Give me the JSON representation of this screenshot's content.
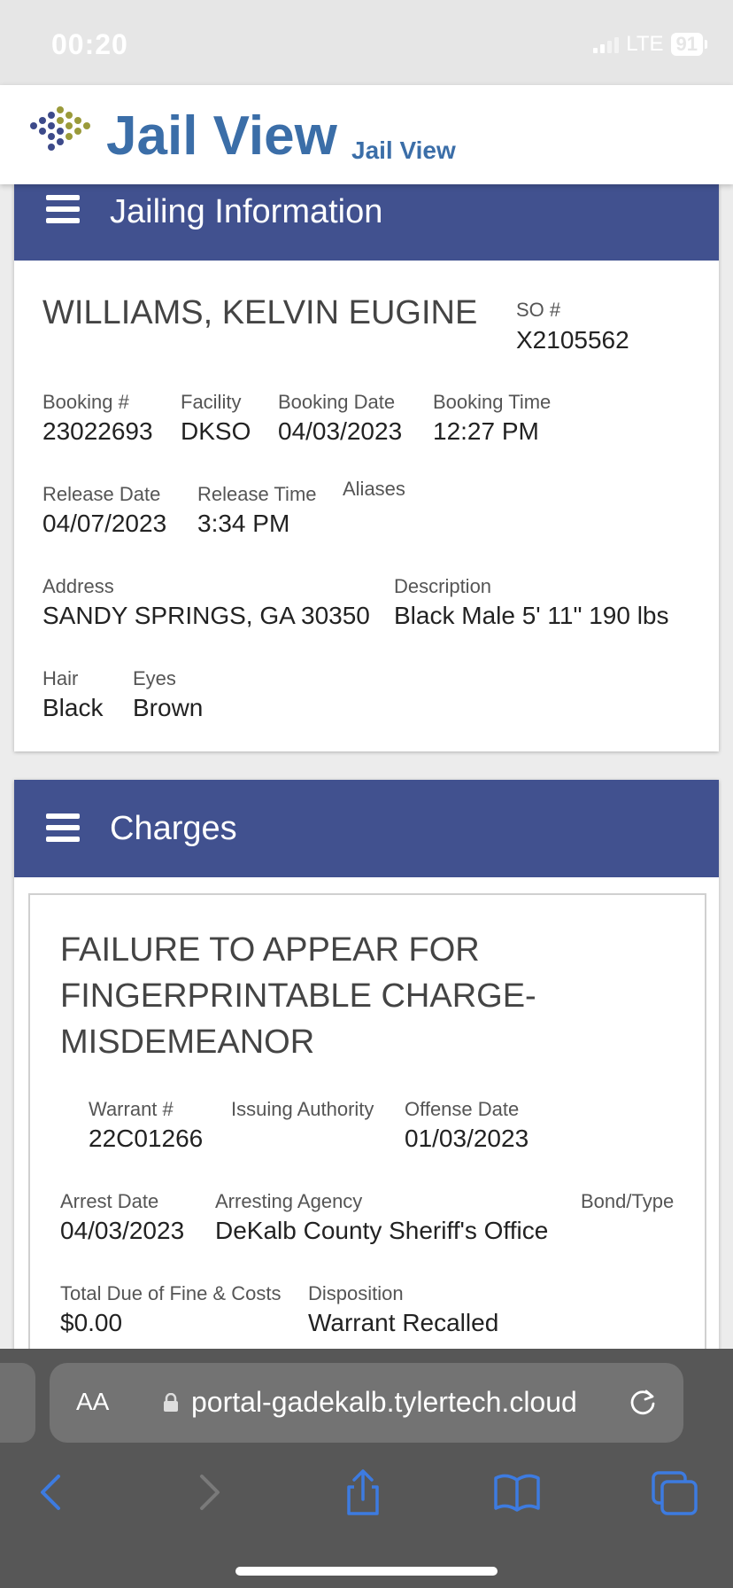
{
  "status_bar": {
    "time": "00:20",
    "network": "LTE",
    "battery": "91"
  },
  "app_header": {
    "title": "Jail View",
    "subtitle": "Jail View"
  },
  "jailing_section": {
    "title": "Jailing Information",
    "name": "WILLIAMS, KELVIN EUGINE",
    "so_label": "SO #",
    "so_value": "X2105562",
    "booking_label": "Booking #",
    "booking_value": "23022693",
    "facility_label": "Facility",
    "facility_value": "DKSO",
    "booking_date_label": "Booking Date",
    "booking_date_value": "04/03/2023",
    "booking_time_label": "Booking Time",
    "booking_time_value": "12:27 PM",
    "release_date_label": "Release Date",
    "release_date_value": "04/07/2023",
    "release_time_label": "Release Time",
    "release_time_value": "3:34 PM",
    "aliases_label": "Aliases",
    "address_label": "Address",
    "address_value": "SANDY SPRINGS, GA 30350",
    "description_label": "Description",
    "description_value": "Black Male 5' 11\" 190 lbs",
    "hair_label": "Hair",
    "hair_value": "Black",
    "eyes_label": "Eyes",
    "eyes_value": "Brown"
  },
  "charges_section": {
    "title": "Charges",
    "charge": {
      "title": "FAILURE TO APPEAR FOR FINGERPRINTABLE CHARGE-MISDEMEANOR",
      "warrant_label": "Warrant #",
      "warrant_value": "22C01266",
      "issuing_label": "Issuing Authority",
      "offense_date_label": "Offense Date",
      "offense_date_value": "01/03/2023",
      "arrest_date_label": "Arrest Date",
      "arrest_date_value": "04/03/2023",
      "arresting_agency_label": "Arresting Agency",
      "arresting_agency_value": "DeKalb County Sheriff's Office",
      "bond_label": "Bond/Type",
      "total_due_label": "Total Due of Fine & Costs",
      "total_due_value": "$0.00",
      "disposition_label": "Disposition",
      "disposition_value": "Warrant Recalled"
    }
  },
  "browser": {
    "aa_label": "AA",
    "url": "portal-gadekalb.tylertech.cloud",
    "icons": [
      "back-icon",
      "forward-icon",
      "share-icon",
      "bookmarks-icon",
      "tabs-icon",
      "reload-icon",
      "lock-icon",
      "menu-icon"
    ]
  },
  "colors": {
    "section_bar": "#41518f",
    "brand_blue": "#3b6ea8",
    "logo_olive": "#9a9a3a",
    "browser_accent": "#3d7be0"
  }
}
